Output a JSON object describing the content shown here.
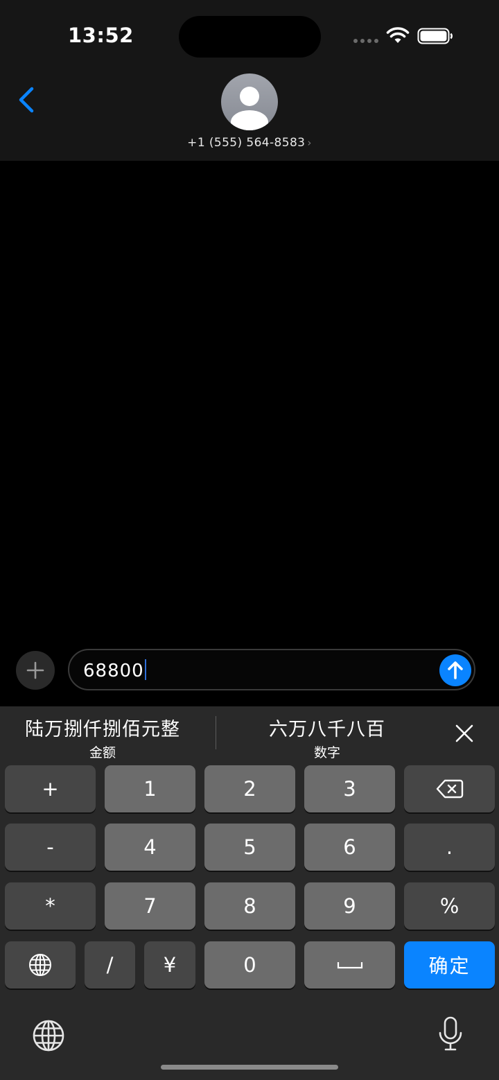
{
  "status_bar": {
    "time": "13:52"
  },
  "header": {
    "contact": "+1 (555) 564-8583",
    "chevron": "›"
  },
  "compose": {
    "text": "68800"
  },
  "candidates": [
    {
      "main": "陆万捌仟捌佰元整",
      "sub": "金额"
    },
    {
      "main": "六万八千八百",
      "sub": "数字"
    }
  ],
  "keys": {
    "row1": [
      "+",
      "1",
      "2",
      "3"
    ],
    "row2": [
      "-",
      "4",
      "5",
      "6",
      "."
    ],
    "row3": [
      "*",
      "7",
      "8",
      "9",
      "%"
    ],
    "row4": [
      "/",
      "¥",
      "0"
    ],
    "confirm": "确定"
  },
  "colors": {
    "accent": "#0a84ff",
    "key_dark": "#464646",
    "key_light": "#6c6c6c",
    "keyboard_bg": "#292929"
  }
}
